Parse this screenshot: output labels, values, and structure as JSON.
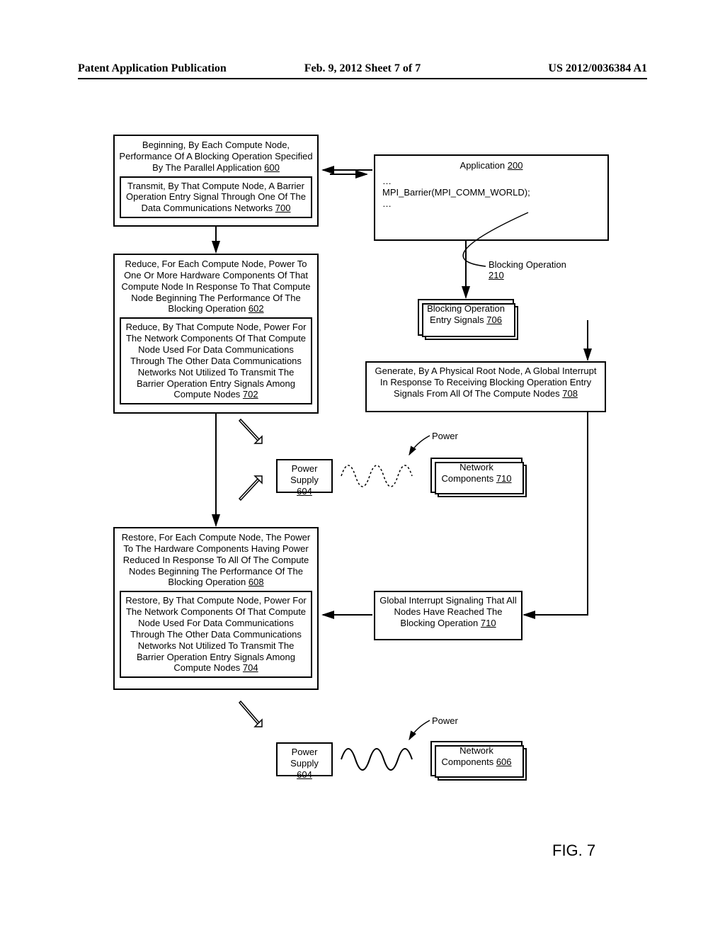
{
  "header": {
    "left": "Patent Application Publication",
    "center": "Feb. 9, 2012  Sheet 7 of 7",
    "right": "US 2012/0036384 A1"
  },
  "figure_label": "FIG. 7",
  "boxes": {
    "b600": "Beginning, By Each Compute Node, Performance Of A Blocking Operation Specified By The Parallel Application ",
    "b600_ref": "600",
    "b700": "Transmit, By That Compute Node, A Barrier Operation Entry Signal Through One Of The Data Communications Networks ",
    "b700_ref": "700",
    "b602": "Reduce, For Each Compute Node, Power To One Or More Hardware Components Of That Compute Node In Response To That Compute Node Beginning The Performance Of The Blocking Operation ",
    "b602_ref": "602",
    "b702": "Reduce, By That Compute Node, Power For The Network Components Of That Compute Node Used For Data Communications Through The Other Data Communications Networks Not Utilized To Transmit The Barrier Operation Entry Signals Among Compute Nodes ",
    "b702_ref": "702",
    "app200_title": "Application ",
    "app200_ref": "200",
    "app200_line1": "…",
    "app200_line2": "MPI_Barrier(MPI_COMM_WORLD);",
    "app200_line3": "…",
    "blocking_op": "Blocking Operation ",
    "blocking_op_ref": "210",
    "entry_signals": "Blocking Operation Entry Signals ",
    "entry_signals_ref": "706",
    "b708": "Generate, By A Physical Root Node, A Global Interrupt In Response To Receiving Blocking Operation Entry Signals From All Of The Compute Nodes ",
    "b708_ref": "708",
    "power_supply": "Power Supply ",
    "power_supply_ref": "604",
    "net_comp_710": "Network Components ",
    "net_comp_710_ref": "710",
    "b608": "Restore, For Each Compute Node, The Power To The Hardware Components Having Power Reduced In Response To All Of The Compute Nodes Beginning The Performance Of The Blocking Operation ",
    "b608_ref": "608",
    "b704": "Restore, By That Compute Node, Power For The Network Components Of That Compute Node Used For Data Communications Through The Other Data Communications Networks Not Utilized To Transmit The Barrier Operation Entry Signals Among Compute Nodes ",
    "b704_ref": "704",
    "global_int": "Global Interrupt Signaling That All Nodes Have Reached The Blocking Operation ",
    "global_int_ref": "710",
    "net_comp_606": "Network Components ",
    "net_comp_606_ref": "606",
    "power_label": "Power"
  }
}
